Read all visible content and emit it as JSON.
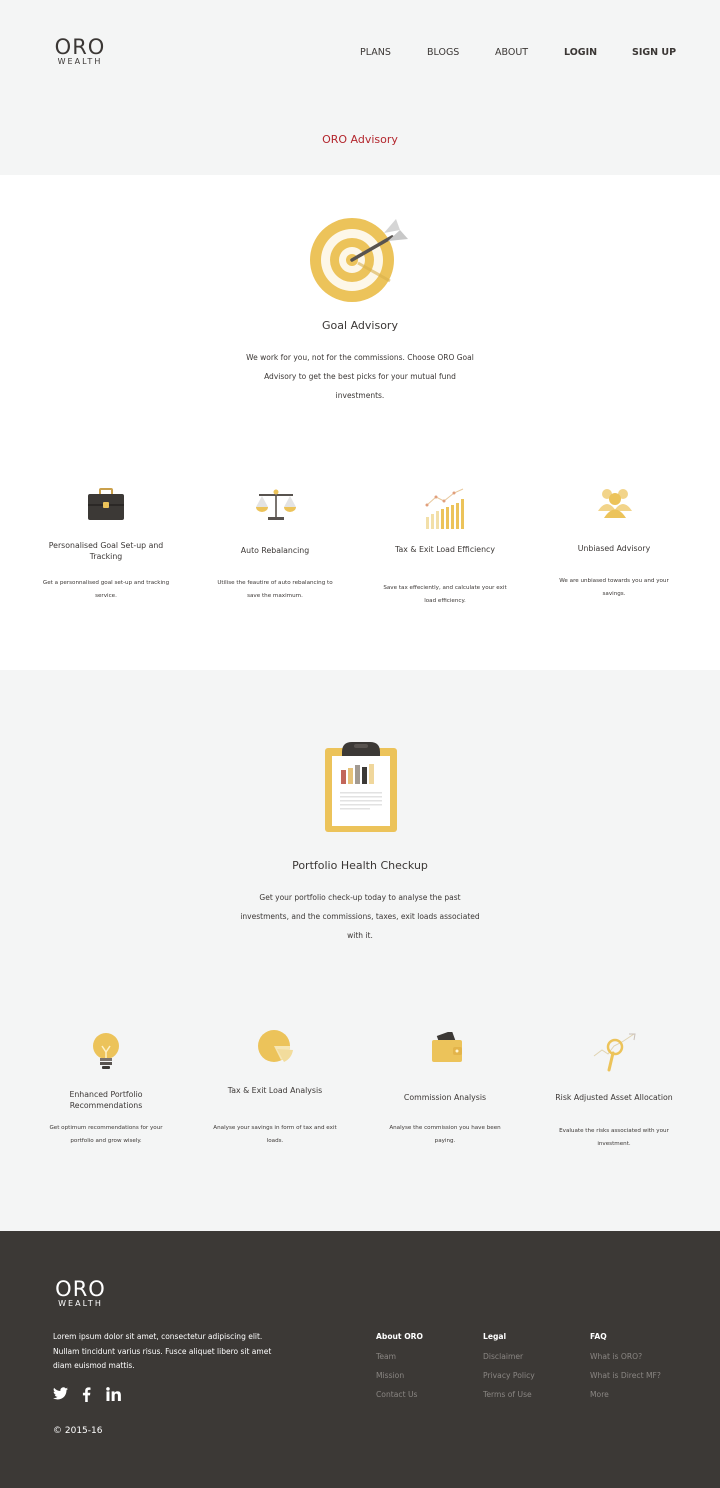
{
  "header": {
    "logo_main": "ORO",
    "logo_sub": "WEALTH",
    "nav": [
      "PLANS",
      "BLOGS",
      "ABOUT"
    ],
    "login": "LOGIN",
    "signup": "SIGN UP",
    "page_title": "ORO Advisory"
  },
  "goal": {
    "title": "Goal Advisory",
    "desc": "We work for you, not for the commissions. Choose ORO Goal Advisory to get the best picks for your mutual fund investments.",
    "features": [
      {
        "icon": "briefcase-icon",
        "title": "Personalised Goal Set-up and Tracking",
        "desc": "Get a personnalised goal set-up and tracking service."
      },
      {
        "icon": "scales-icon",
        "title": "Auto Rebalancing",
        "desc": "Utilise the feautire of auto rebalancing to save the maximum."
      },
      {
        "icon": "growth-chart-icon",
        "title": "Tax & Exit Load Efficiency",
        "desc": "Save tax effeciently, and calculate your exit load efficiency."
      },
      {
        "icon": "people-icon",
        "title": "Unbiased Advisory",
        "desc": "We are unbiased towards you and your savings."
      }
    ]
  },
  "portfolio": {
    "title": "Portfolio Health Checkup",
    "desc": "Get your portfolio check-up today to analyse the past investments, and the commissions, taxes, exit loads associated with it.",
    "features": [
      {
        "icon": "lightbulb-icon",
        "title": "Enhanced Portfolio Recommendations",
        "desc": "Get optimum recommendations for your portfolio and grow wisely."
      },
      {
        "icon": "pie-chart-icon",
        "title": "Tax & Exit Load Analysis",
        "desc": "Analyse your savings in form of tax and exit loads."
      },
      {
        "icon": "wallet-icon",
        "title": "Commission Analysis",
        "desc": "Analyse the commission you have been paying."
      },
      {
        "icon": "magnifier-icon",
        "title": "Risk Adjusted Asset Allocation",
        "desc": "Evaluate the risks associated with your investment."
      }
    ]
  },
  "footer": {
    "logo_main": "ORO",
    "logo_sub": "WEALTH",
    "text": "Lorem ipsum dolor sit amet, consectetur adipiscing elit. Nullam tincidunt varius risus. Fusce aliquet libero sit amet diam euismod mattis.",
    "copyright": "© 2015-16",
    "columns": [
      {
        "heading": "About ORO",
        "links": [
          "Team",
          "Mission",
          "Contact Us"
        ]
      },
      {
        "heading": "Legal",
        "links": [
          "Disclaimer",
          "Privacy Policy",
          "Terms of Use"
        ]
      },
      {
        "heading": "FAQ",
        "links": [
          "What is ORO?",
          "What is Direct MF?",
          "More"
        ]
      }
    ]
  },
  "colors": {
    "accent": "#b3262d",
    "gold": "#ecc35a",
    "dark": "#3c3936",
    "light_bg": "#f4f5f5"
  }
}
